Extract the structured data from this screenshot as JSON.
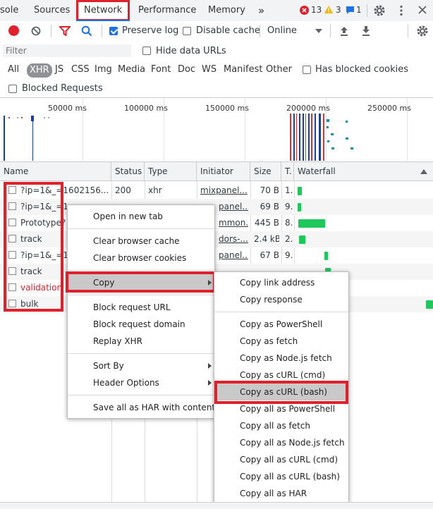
{
  "tabs": {
    "console": "sole",
    "sources": "Sources",
    "network": "Network",
    "performance": "Performance",
    "memory": "Memory",
    "more": "»"
  },
  "status": {
    "errors": "13",
    "warnings": "3",
    "messages": "1"
  },
  "toolbar": {
    "preserve_log": "Preserve log",
    "disable_cache": "Disable cache",
    "throttling": "Online"
  },
  "filter": {
    "placeholder": "Filter",
    "hide_data_urls": "Hide data URLs",
    "types": [
      "All",
      "XHR",
      "JS",
      "CSS",
      "Img",
      "Media",
      "Font",
      "Doc",
      "WS",
      "Manifest",
      "Other"
    ],
    "selected_type": "XHR",
    "has_blocked_cookies": "Has blocked cookies",
    "blocked_requests": "Blocked Requests"
  },
  "overview": {
    "ticks": [
      "50000 ms",
      "100000 ms",
      "150000 ms",
      "200000 ms",
      "250000 ms"
    ]
  },
  "table": {
    "headers": {
      "name": "Name",
      "status": "Status",
      "type": "Type",
      "initiator": "Initiator",
      "size": "Size",
      "time": "T.",
      "waterfall": "Waterfall"
    },
    "rows": [
      {
        "name": "?ip=1&_=1602156...",
        "status": "200",
        "type": "xhr",
        "initiator": "mixpanel...",
        "size": "70 B",
        "time": "1."
      },
      {
        "name": "?ip=1&_=1",
        "status": "",
        "type": "",
        "initiator": "panel...",
        "size": "69 B",
        "time": "9."
      },
      {
        "name": "Prototype?",
        "status": "",
        "type": "",
        "initiator": "mmon...",
        "size": "445 B",
        "time": "8."
      },
      {
        "name": "track",
        "status": "",
        "type": "",
        "initiator": "dors-...",
        "size": "2.4 kB",
        "time": "2."
      },
      {
        "name": "?ip=1&_=1",
        "status": "",
        "type": "",
        "initiator": "panel...",
        "size": "67 B",
        "time": "9."
      },
      {
        "name": "track",
        "status": "",
        "type": "",
        "initiator": "",
        "size": "",
        "time": ""
      },
      {
        "name": "validation",
        "status": "",
        "type": "",
        "initiator": "",
        "size": "",
        "time": ""
      },
      {
        "name": "bulk",
        "status": "",
        "type": "",
        "initiator": "",
        "size": "",
        "time": ""
      }
    ]
  },
  "context_menu": {
    "open_new_tab": "Open in new tab",
    "clear_cache": "Clear browser cache",
    "clear_cookies": "Clear browser cookies",
    "copy": "Copy",
    "block_url": "Block request URL",
    "block_domain": "Block request domain",
    "replay_xhr": "Replay XHR",
    "sort_by": "Sort By",
    "header_options": "Header Options",
    "save_har": "Save all as HAR with content"
  },
  "copy_menu": {
    "link_address": "Copy link address",
    "response": "Copy response",
    "as_powershell": "Copy as PowerShell",
    "as_fetch": "Copy as fetch",
    "as_nodejs_fetch": "Copy as Node.js fetch",
    "as_curl_cmd": "Copy as cURL (cmd)",
    "as_curl_bash": "Copy as cURL (bash)",
    "all_powershell": "Copy all as PowerShell",
    "all_fetch": "Copy all as fetch",
    "all_nodejs_fetch": "Copy all as Node.js fetch",
    "all_curl_cmd": "Copy all as cURL (cmd)",
    "all_curl_bash": "Copy all as cURL (bash)",
    "all_har": "Copy all as HAR"
  },
  "colors": {
    "accent": "#1a73e8",
    "highlight_box": "#e0202a",
    "waterfall_bar": "#1ec85a",
    "error_text": "#e0202a"
  }
}
